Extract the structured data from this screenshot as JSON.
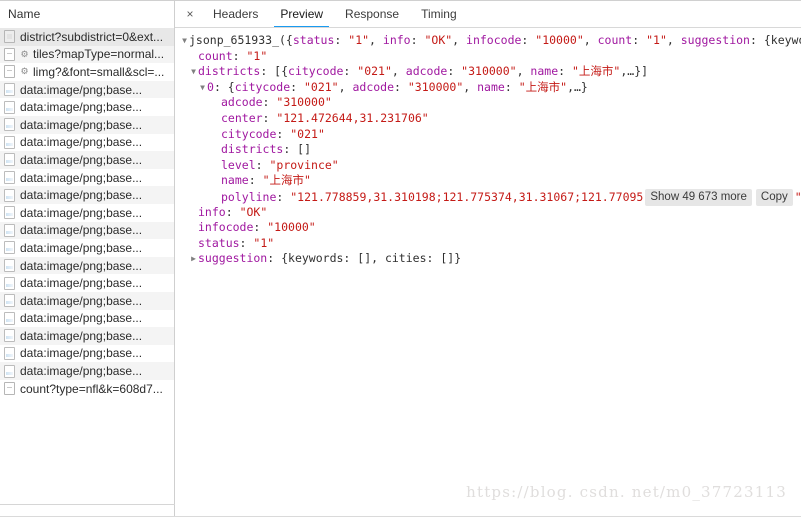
{
  "panel": {
    "sidebar_column_header": "Name",
    "close_icon_glyph": "×"
  },
  "tabs": [
    {
      "label": "Headers",
      "active": false
    },
    {
      "label": "Preview",
      "active": true
    },
    {
      "label": "Response",
      "active": false
    },
    {
      "label": "Timing",
      "active": false
    }
  ],
  "accent_color": "#1a9bf0",
  "key_color": "#a018a0",
  "string_color": "#c41a16",
  "requests": [
    {
      "label": "district?subdistrict=0&ext...",
      "icon": "document-icon",
      "selected": true,
      "gear": false
    },
    {
      "label": "tiles?mapType=normal...",
      "icon": "document-icon",
      "selected": false,
      "gear": true
    },
    {
      "label": "limg?&font=small&scl=...",
      "icon": "document-icon",
      "selected": false,
      "gear": true
    },
    {
      "label": "data:image/png;base...",
      "icon": "image-icon",
      "selected": false,
      "gear": false
    },
    {
      "label": "data:image/png;base...",
      "icon": "image-icon",
      "selected": false,
      "gear": false
    },
    {
      "label": "data:image/png;base...",
      "icon": "image-icon",
      "selected": false,
      "gear": false
    },
    {
      "label": "data:image/png;base...",
      "icon": "image-icon",
      "selected": false,
      "gear": false
    },
    {
      "label": "data:image/png;base...",
      "icon": "image-icon",
      "selected": false,
      "gear": false
    },
    {
      "label": "data:image/png;base...",
      "icon": "image-icon",
      "selected": false,
      "gear": false
    },
    {
      "label": "data:image/png;base...",
      "icon": "image-icon",
      "selected": false,
      "gear": false
    },
    {
      "label": "data:image/png;base...",
      "icon": "image-icon",
      "selected": false,
      "gear": false
    },
    {
      "label": "data:image/png;base...",
      "icon": "image-icon",
      "selected": false,
      "gear": false
    },
    {
      "label": "data:image/png;base...",
      "icon": "image-icon",
      "selected": false,
      "gear": false
    },
    {
      "label": "data:image/png;base...",
      "icon": "image-icon",
      "selected": false,
      "gear": false
    },
    {
      "label": "data:image/png;base...",
      "icon": "image-icon",
      "selected": false,
      "gear": false
    },
    {
      "label": "data:image/png;base...",
      "icon": "image-icon",
      "selected": false,
      "gear": false
    },
    {
      "label": "data:image/png;base...",
      "icon": "image-icon",
      "selected": false,
      "gear": false
    },
    {
      "label": "data:image/png;base...",
      "icon": "image-icon",
      "selected": false,
      "gear": false
    },
    {
      "label": "data:image/png;base...",
      "icon": "image-icon",
      "selected": false,
      "gear": false
    },
    {
      "label": "data:image/png;base...",
      "icon": "image-icon",
      "selected": false,
      "gear": false
    },
    {
      "label": "count?type=nfl&k=608d7...",
      "icon": "document-icon",
      "selected": false,
      "gear": false
    }
  ],
  "preview": {
    "root": {
      "prefix": "jsonp_651933_({",
      "status_key": "status",
      "status_value": "\"1\"",
      "info_key": "info",
      "info_value": "\"OK\"",
      "infocode_key": "infocode",
      "infocode_value": "\"10000\"",
      "count_key": "count",
      "count_value": "\"1\"",
      "suggestion_key": "suggestion",
      "suggestion_tail": "{keywords"
    },
    "count": {
      "key": "count",
      "value": "\"1\""
    },
    "districts": {
      "key": "districts",
      "summary_open": "[{",
      "citycode_key": "citycode",
      "citycode_value": "\"021\"",
      "adcode_key": "adcode",
      "adcode_value": "\"310000\"",
      "name_key": "name",
      "name_value": "上海市",
      "summary_close": ",…}]"
    },
    "item0": {
      "index": "0",
      "summary_open": "{",
      "citycode_key": "citycode",
      "citycode_value": "\"021\"",
      "adcode_key": "adcode",
      "adcode_value": "\"310000\"",
      "name_key": "name",
      "name_value": "上海市",
      "summary_close": ",…}"
    },
    "fields": {
      "adcode_key": "adcode",
      "adcode_value": "\"310000\"",
      "center_key": "center",
      "center_value": "\"121.472644,31.231706\"",
      "citycode_key": "citycode",
      "citycode_value": "\"021\"",
      "districts_key": "districts",
      "districts_value": "[]",
      "level_key": "level",
      "level_value": "\"province\"",
      "name_key": "name",
      "name_value": "上海市",
      "polyline_key": "polyline",
      "polyline_value": "\"121.778859,31.310198;121.775374,31.31067;121.77095",
      "polyline_show_more": "Show 49 673 more",
      "polyline_copy": "Copy",
      "polyline_tail_quote": "\""
    },
    "tail": {
      "info_key": "info",
      "info_value": "\"OK\"",
      "infocode_key": "infocode",
      "infocode_value": "\"10000\"",
      "status_key": "status",
      "status_value": "\"1\"",
      "suggestion_key": "suggestion",
      "suggestion_value": "{keywords: [], cities: []}"
    }
  },
  "watermark": "https://blog. csdn. net/m0_37723113"
}
